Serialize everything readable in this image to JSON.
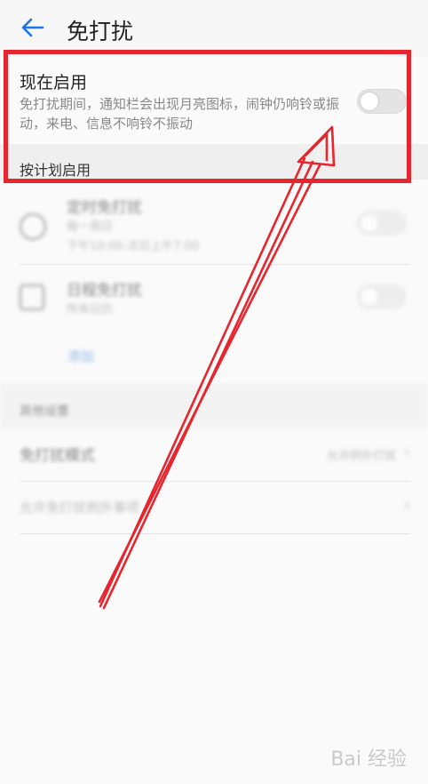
{
  "header": {
    "title": "免打扰",
    "back_icon": "arrow-left-icon"
  },
  "now_enable": {
    "title": "现在启用",
    "subtitle": "免打扰期间，通知栏会出现月亮图标，闹钟仍响铃或振动，来电、信息不响铃不振动",
    "toggle_on": false
  },
  "schedule_section": {
    "label": "按计划启用"
  },
  "scheduled_items": [
    {
      "title": "定时免打扰",
      "sub1": "每一周日",
      "sub2": "下午10:00-次日上午7:00",
      "toggle_on": false
    },
    {
      "title": "日程免打扰",
      "sub1": "所有日历",
      "toggle_on": false
    }
  ],
  "add_label": "添加",
  "other_section": {
    "label": "其他设置"
  },
  "dnd_mode": {
    "label": "免打扰模式",
    "value": "允许例外打扰"
  },
  "exceptions_label": "允许免打扰例外事项",
  "watermark": "Bai 经验",
  "colors": {
    "accent": "#1a73e8",
    "annotation": "#e5262e",
    "link_blue": "#3b82d6"
  }
}
